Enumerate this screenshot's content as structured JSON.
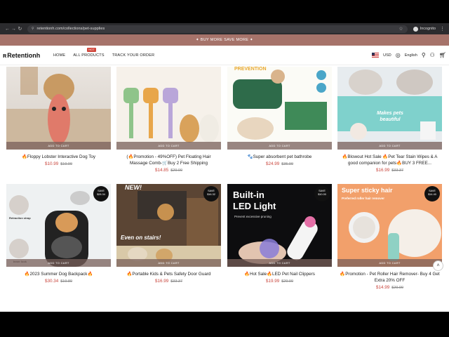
{
  "browser": {
    "url": "retentionh.com/collections/pet-supplies",
    "profile": "Incognito"
  },
  "promo": "✦ BUY MORE SAVE MORE ✦",
  "header": {
    "logo": "Retentionh",
    "menu": [
      "HOME",
      "ALL PRODUCTS",
      "TRACK YOUR ORDER"
    ],
    "hot_badge": "HOT",
    "currency": "USD",
    "language": "English"
  },
  "add_to_cart": "ADD TO CART",
  "products": [
    {
      "title": "🔥Floppy Lobster Interactive Dog Toy",
      "price": "$10.99",
      "old": "$19.99"
    },
    {
      "title": "(🔥Promotion - 49%OFF) Pet Floating Hair Massage Comb-🛒Buy 2 Free Shipping",
      "price": "$14.85",
      "old": "$29.00"
    },
    {
      "title": "🐾Super absorbent pet bathrobe",
      "price": "$24.99",
      "old": "$35.99"
    },
    {
      "title": "🔥Blowout Hot Sale 🔥Pet Tear Stain Wipes & A good companion for pets🔥BUY 3 FREE...",
      "price": "$16.99",
      "old": "$33.37"
    },
    {
      "title": "🔥2023 Summer Dog Backpack🔥",
      "price": "$30.34",
      "old": "$19.89",
      "badge": "SAVE $28.34"
    },
    {
      "title": "🔥Portable Kids & Pets Safety Door Guard",
      "price": "$16.99",
      "old": "$33.37",
      "badge": "SAVE $16.32"
    },
    {
      "title": "🔥Hot Sale🔥LED Pet Nail Clippers",
      "price": "$19.99",
      "old": "$29.99",
      "badge": "SAVE $10.00"
    },
    {
      "title": "🔥Promotion - Pet Roller Hair Remover- Buy 4 Get Extra 20% OFF",
      "price": "$14.99",
      "old": "$29.99",
      "badge": "SAVE $14.40"
    }
  ],
  "overlays": {
    "p3_prevention": "PREVENTION",
    "p4_makes": "Makes pets beautiful",
    "p5_retraction": "Retraction strap",
    "p5_inner": "Inner lock",
    "p6_new": "NEW!",
    "p6_stairs": "Even on stairs!",
    "p7_builtin": "Built-in",
    "p7_led": "LED Light",
    "p7_sub": "Prevent excessive pruning",
    "p8_sticky": "Super sticky hair",
    "p8_sub": "Preferred roller hair remover"
  }
}
